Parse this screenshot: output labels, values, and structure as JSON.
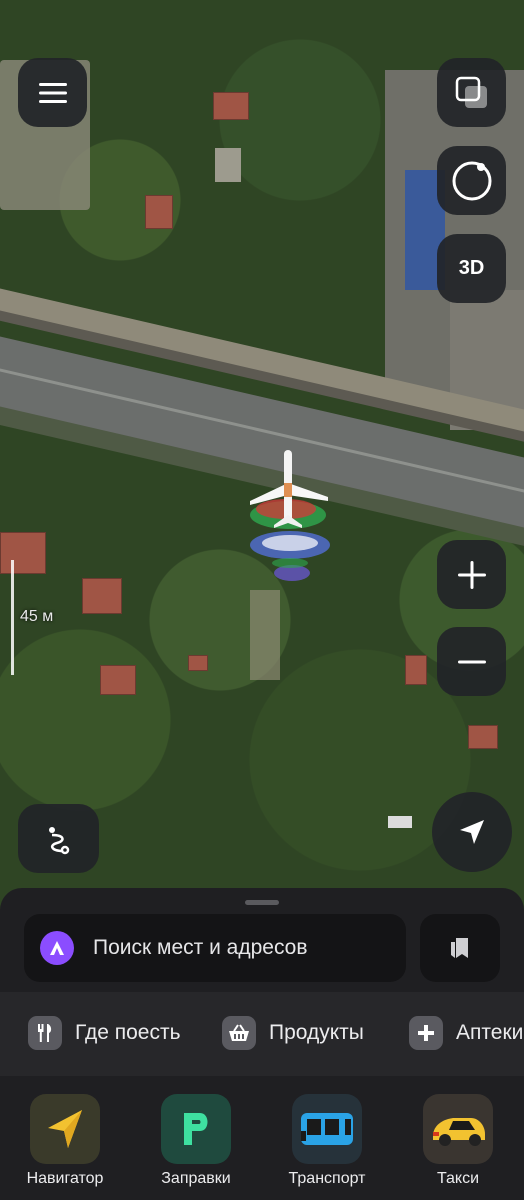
{
  "map": {
    "scale_label": "45 м",
    "mode_3d_label": "3D"
  },
  "search": {
    "placeholder": "Поиск мест и адресов"
  },
  "categories": [
    {
      "label": "Где поесть",
      "icon": "fork-knife-icon"
    },
    {
      "label": "Продукты",
      "icon": "basket-icon"
    },
    {
      "label": "Аптеки",
      "icon": "plus-icon"
    }
  ],
  "apps": [
    {
      "label": "Навигатор",
      "icon": "navigator-icon",
      "color": "#3a3a2a"
    },
    {
      "label": "Заправки",
      "icon": "fuel-icon",
      "color": "#1f4a3e"
    },
    {
      "label": "Транспорт",
      "icon": "bus-icon",
      "color": "#26323a"
    },
    {
      "label": "Такси",
      "icon": "taxi-car-icon",
      "color": "#3a3530"
    }
  ],
  "colors": {
    "accent_alice": "#8b4dff",
    "sheet_bg": "#1f1f22",
    "control_bg": "#222428"
  }
}
